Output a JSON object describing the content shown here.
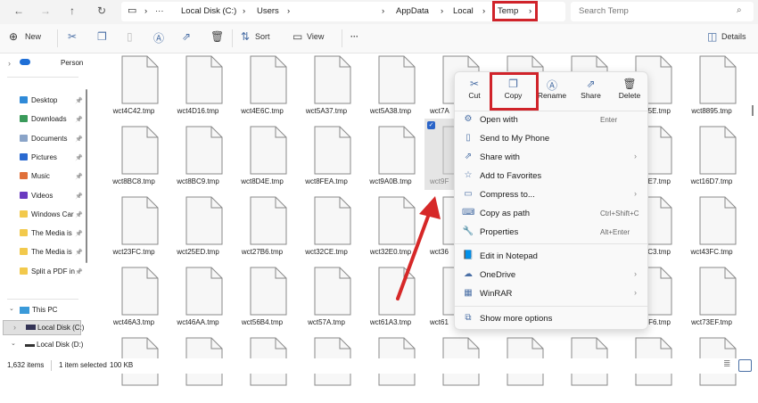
{
  "nav": {
    "back": "←",
    "forward": "→",
    "up": "↑",
    "refresh": "↻"
  },
  "breadcrumb": {
    "more": "···",
    "items": [
      "Local Disk (C:)",
      "Users",
      "AppData",
      "Local",
      "Temp"
    ]
  },
  "search": {
    "placeholder": "Search Temp"
  },
  "toolbar": {
    "new": "New",
    "sort": "Sort",
    "view": "View",
    "more": "···",
    "details": "Details"
  },
  "sidebar": {
    "onedrive": "Person",
    "quick": [
      "Desktop",
      "Downloads",
      "Documents",
      "Pictures",
      "Music",
      "Videos",
      "Windows Car",
      "The Media is",
      "The Media is",
      "Split a PDF in"
    ],
    "this_pc": "This PC",
    "drives": [
      "Local Disk (C:)",
      "Local Disk (D:)"
    ]
  },
  "files": [
    [
      "wct4C42.tmp",
      "wct4D16.tmp",
      "wct4E6C.tmp",
      "wct5A37.tmp",
      "wct5A38.tmp",
      "wct7A",
      "",
      "",
      "5E.tmp",
      "wct8895.tmp"
    ],
    [
      "wct8BC8.tmp",
      "wct8BC9.tmp",
      "wct8D4E.tmp",
      "wct8FEA.tmp",
      "wct9A0B.tmp",
      "wct9F",
      "",
      "",
      "E7.tmp",
      "wct16D7.tmp"
    ],
    [
      "wct23FC.tmp",
      "wct25ED.tmp",
      "wct27B6.tmp",
      "wct32CE.tmp",
      "wct32E0.tmp",
      "wct36",
      "",
      "",
      "C3.tmp",
      "wct43FC.tmp"
    ],
    [
      "wct46A3.tmp",
      "wct46AA.tmp",
      "wct56B4.tmp",
      "wct57A.tmp",
      "wct61A3.tmp",
      "wct61",
      "",
      "",
      "F6.tmp",
      "wct73EF.tmp"
    ]
  ],
  "context_menu": {
    "quick": [
      "Cut",
      "Copy",
      "Rename",
      "Share",
      "Delete"
    ],
    "items": [
      {
        "label": "Open with",
        "shortcut": "Enter"
      },
      {
        "label": "Send to My Phone"
      },
      {
        "label": "Share with",
        "arrow": "›"
      },
      {
        "label": "Add to Favorites"
      },
      {
        "label": "Compress to...",
        "arrow": "›"
      },
      {
        "label": "Copy as path",
        "shortcut": "Ctrl+Shift+C"
      },
      {
        "label": "Properties",
        "shortcut": "Alt+Enter"
      },
      {
        "label": "Edit in Notepad"
      },
      {
        "label": "OneDrive",
        "arrow": "›"
      },
      {
        "label": "WinRAR",
        "arrow": "›"
      },
      {
        "label": "Show more options"
      }
    ]
  },
  "status": {
    "count": "1,632 items",
    "selected": "1 item selected",
    "size": "100 KB"
  },
  "colors": {
    "highlight": "#d0232a",
    "accent": "#4a6fa5"
  }
}
